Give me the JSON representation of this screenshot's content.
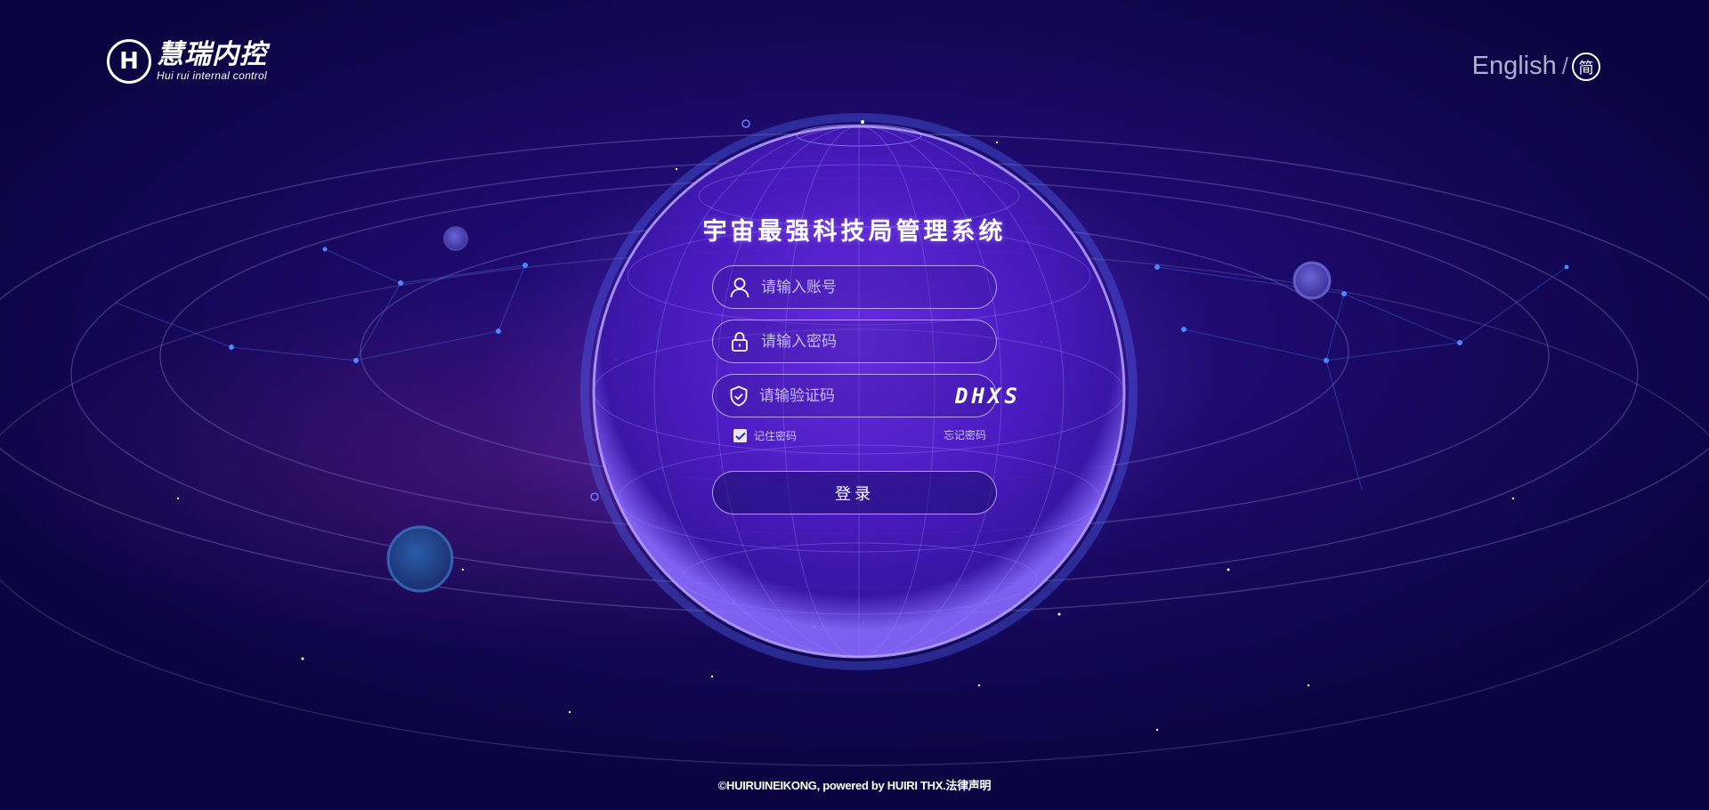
{
  "logo": {
    "mark": "H",
    "name_cn": "慧瑞内控",
    "name_en": "Hui rui internal control"
  },
  "language": {
    "english": "English",
    "separator": "/",
    "chinese": "简"
  },
  "form": {
    "title": "宇宙最强科技局管理系统",
    "username_placeholder": "请输入账号",
    "password_placeholder": "请输入密码",
    "captcha_placeholder": "请输验证码",
    "captcha_code": "DHXS",
    "remember_label": "记住密码",
    "remember_checked": true,
    "forgot_label": "忘记密码",
    "login_label": "登录"
  },
  "footer": {
    "text": "©HUIRUINEIKONG, powered by HUIRI THX.法律声明"
  },
  "colors": {
    "background_dark": "#0c0440",
    "background_mid": "#1c0a6a",
    "glow": "#7a3ce6",
    "input_border": "#c8beff",
    "text_light": "#ffffff",
    "text_muted": "#c3bff0"
  },
  "icons": {
    "username": "user-icon",
    "password": "lock-icon",
    "captcha": "shield-check-icon",
    "remember": "checkbox-checked-icon"
  }
}
